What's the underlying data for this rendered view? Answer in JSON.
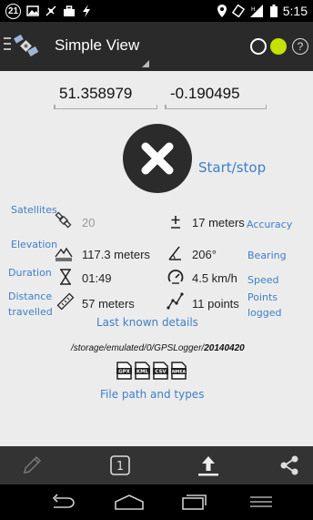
{
  "status_bar": {
    "notification_count": "21",
    "time": "5:15"
  },
  "action_bar": {
    "title": "Simple View",
    "help_glyph": "?"
  },
  "coordinates": {
    "latitude": "51.358979",
    "longitude": "-0.190495"
  },
  "annotations": {
    "start_stop": "Start/stop",
    "satellites": "Satellites",
    "accuracy": "Accuracy",
    "elevation": "Elevation",
    "bearing": "Bearing",
    "duration": "Duration",
    "speed": "Speed",
    "distance_line1": "Distance",
    "distance_line2": "travelled",
    "points_line1": "Points",
    "points_line2": "logged",
    "last_known": "Last known details",
    "file_path_types": "File path and types"
  },
  "details": {
    "satellites": "20",
    "accuracy": "17 meters",
    "elevation": "117.3 meters",
    "bearing": "206°",
    "duration": "01:49",
    "speed": "4.5 km/h",
    "distance": "57 meters",
    "points": "11 points"
  },
  "file": {
    "path_prefix": "/storage/emulated/0/GPSLogger/",
    "path_folder": "20140420",
    "types": [
      "GPX",
      "KML",
      "CSV",
      "NMEA"
    ]
  },
  "toolbar": {
    "page_indicator": "1"
  },
  "colors": {
    "accent_green": "#c6e000",
    "annotation_blue": "#3d7fc8",
    "start_button": "#2b2b2b"
  },
  "icons": {
    "annotate": "pencil-icon",
    "page": "page-one-icon",
    "upload": "upload-icon",
    "share": "share-icon",
    "nav_back": "back-icon",
    "nav_home": "home-icon",
    "nav_recents": "recents-icon",
    "nav_menu": "menu-icon"
  }
}
